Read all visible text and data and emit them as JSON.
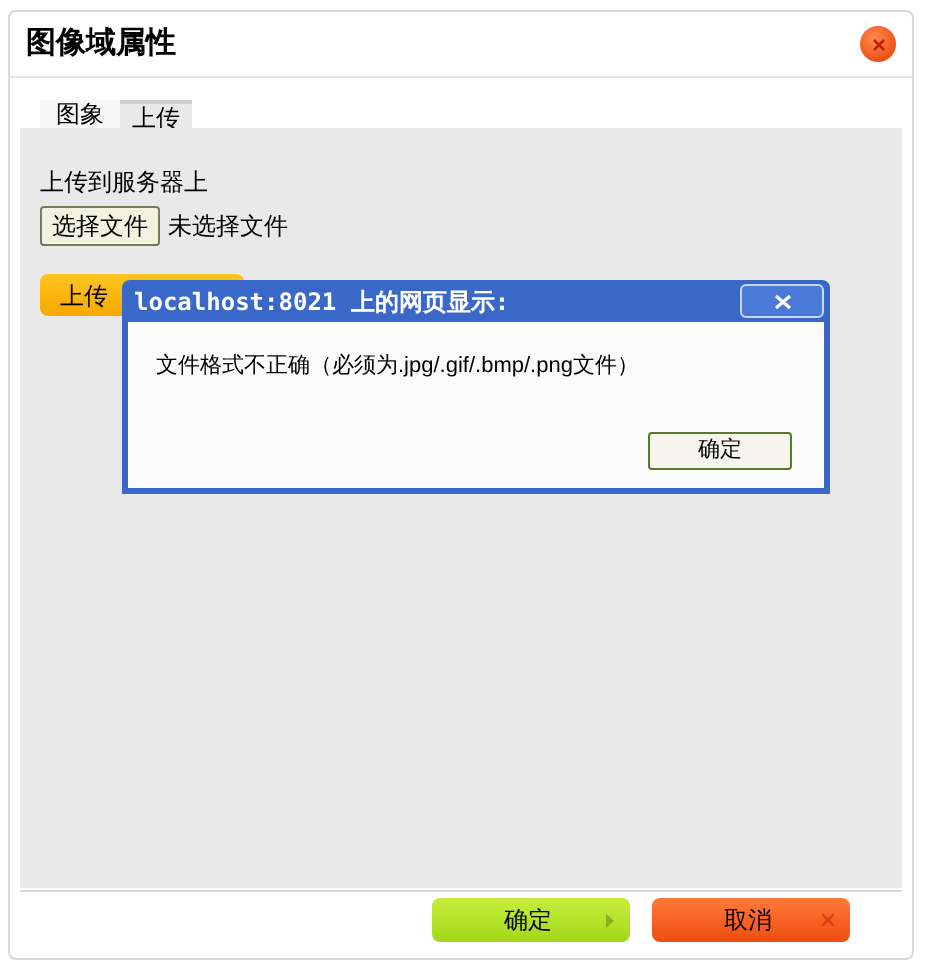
{
  "dialog": {
    "title": "图像域属性",
    "tabs": [
      {
        "label": "图象",
        "selected": false
      },
      {
        "label": "上传",
        "selected": true
      }
    ],
    "upload_label": "上传到服务器上",
    "file_button": "选择文件",
    "file_status": "未选择文件",
    "upload_button": "上传",
    "buttons": [
      {
        "label": "确定",
        "kind": "ok"
      },
      {
        "label": "取消",
        "kind": "cancel"
      }
    ]
  },
  "alert": {
    "title": "localhost:8021 上的网页显示:",
    "message": "文件格式不正确（必须为.jpg/.gif/.bmp/.png文件）",
    "button": "确定"
  }
}
